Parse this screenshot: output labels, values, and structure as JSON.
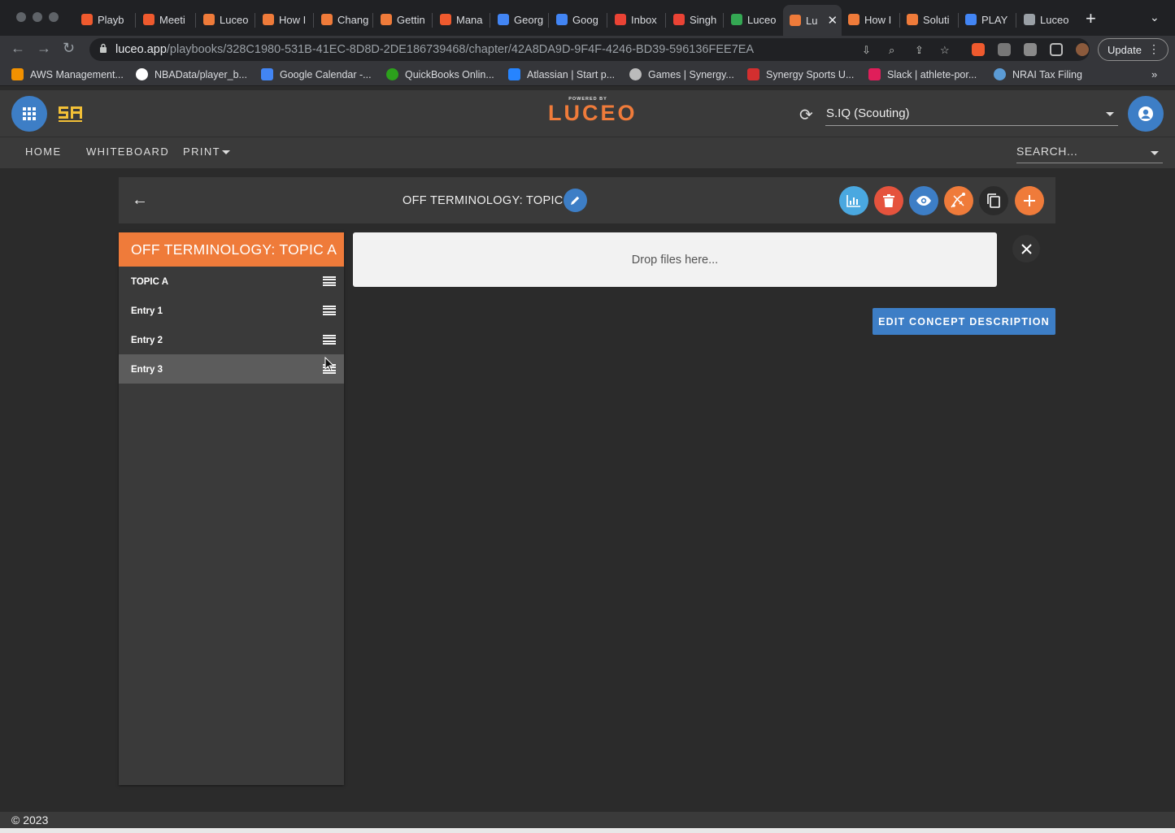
{
  "browser": {
    "tabs": [
      {
        "label": "Playb",
        "color": "#ef5a2e"
      },
      {
        "label": "Meeti",
        "color": "#ef5a2e"
      },
      {
        "label": "Luceo",
        "color": "#ef7b3a"
      },
      {
        "label": "How I",
        "color": "#ef7b3a"
      },
      {
        "label": "Chang",
        "color": "#ef7b3a"
      },
      {
        "label": "Gettin",
        "color": "#ef7b3a"
      },
      {
        "label": "Mana",
        "color": "#ef5a2e"
      },
      {
        "label": "Georg",
        "color": "#4285f4"
      },
      {
        "label": "Goog",
        "color": "#4285f4"
      },
      {
        "label": "Inbox",
        "color": "#ea4335"
      },
      {
        "label": "Singh",
        "color": "#ea4335"
      },
      {
        "label": "Luceo",
        "color": "#34a853"
      },
      {
        "label": "Lu",
        "color": "#ef7b3a"
      },
      {
        "label": "How I",
        "color": "#ef7b3a"
      },
      {
        "label": "Soluti",
        "color": "#ef7b3a"
      },
      {
        "label": "PLAY",
        "color": "#4285f4"
      },
      {
        "label": "Luceo",
        "color": "#9aa0a6"
      }
    ],
    "url_host": "luceo.app",
    "url_path": "/playbooks/328C1980-531B-41EC-8D8D-2DE186739468/chapter/42A8DA9D-9F4F-4246-BD39-596136FEE7EA",
    "update_label": "Update",
    "bookmarks": [
      {
        "label": "AWS Management...",
        "color": "#f29100"
      },
      {
        "label": "NBAData/player_b...",
        "color": "#ffffff"
      },
      {
        "label": "Google Calendar -...",
        "color": "#4285f4"
      },
      {
        "label": "QuickBooks Onlin...",
        "color": "#2ca01c"
      },
      {
        "label": "Atlassian | Start p...",
        "color": "#2684ff"
      },
      {
        "label": "Games | Synergy...",
        "color": "#bbbbbb"
      },
      {
        "label": "Synergy Sports U...",
        "color": "#d32f2f"
      },
      {
        "label": "Slack | athlete-por...",
        "color": "#e01e5a"
      },
      {
        "label": "NRAI Tax Filing",
        "color": "#5b9bd5"
      }
    ]
  },
  "app": {
    "logo_powered": "POWERED BY",
    "logo_text": "LUCEO",
    "org_selected": "S.IQ (Scouting)",
    "nav": {
      "home": "HOME",
      "whiteboard": "WHITEBOARD",
      "print": "PRINT"
    },
    "search_placeholder": "SEARCH...",
    "page_title": "OFF TERMINOLOGY: TOPIC A",
    "sidebar": {
      "header": "OFF TERMINOLOGY: TOPIC A",
      "items": [
        {
          "label": "TOPIC A"
        },
        {
          "label": "Entry 1"
        },
        {
          "label": "Entry 2"
        },
        {
          "label": "Entry 3",
          "selected": true
        }
      ]
    },
    "dropzone_text": "Drop files here...",
    "edit_desc_label": "EDIT CONCEPT DESCRIPTION",
    "footer": "© 2023",
    "colors": {
      "accent_orange": "#ef7b3a",
      "accent_blue": "#3d7ec6",
      "danger_red": "#e5533d"
    }
  }
}
